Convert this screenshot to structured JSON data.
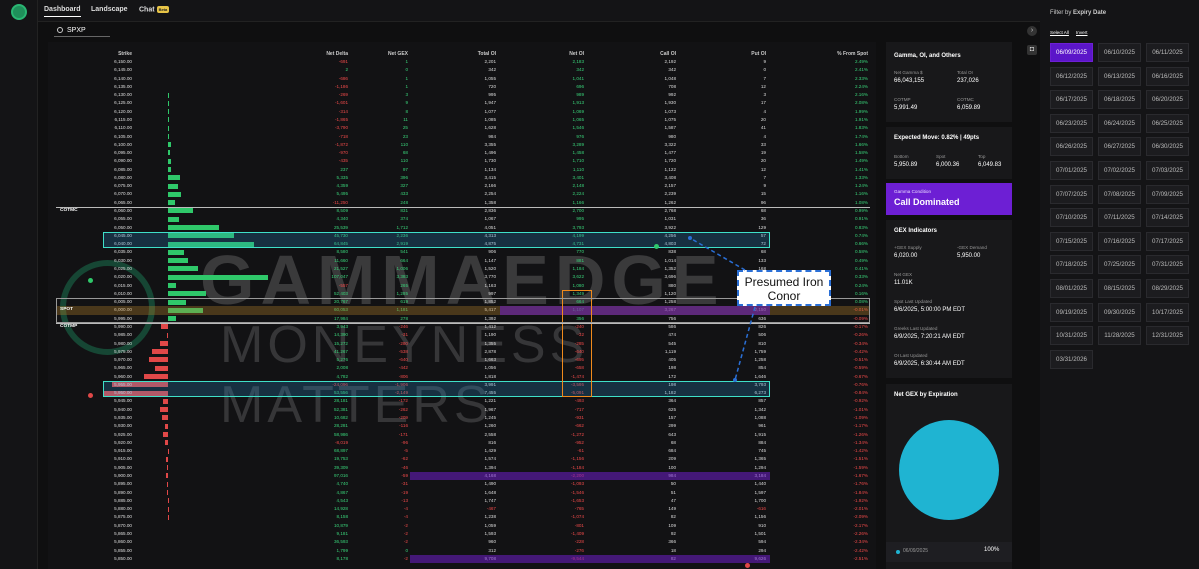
{
  "nav": {
    "tabs": [
      "Dashboard",
      "Landscape",
      "Chat"
    ],
    "beta": "Beta"
  },
  "search": {
    "value": "SPXP"
  },
  "table": {
    "headers": [
      "Strike",
      "Net Delta",
      "Net GEX",
      "Total OI",
      "Net OI",
      "Call OI",
      "Put OI",
      "% From Spot"
    ],
    "rows": [
      [
        "6,150.00",
        "-691",
        "1",
        "2,201",
        "2,183",
        "2,192",
        "9",
        "2.49%"
      ],
      [
        "6,145.00",
        "2",
        "0",
        "342",
        "342",
        "342",
        "0",
        "2.41%"
      ],
      [
        "6,140.00",
        "-686",
        "1",
        "1,055",
        "1,041",
        "1,048",
        "7",
        "2.33%"
      ],
      [
        "6,135.00",
        "-1,186",
        "1",
        "720",
        "696",
        "708",
        "12",
        "2.24%"
      ],
      [
        "6,130.00",
        "-269",
        "3",
        "995",
        "989",
        "992",
        "3",
        "2.16%"
      ],
      [
        "6,125.00",
        "-1,601",
        "9",
        "1,947",
        "1,913",
        "1,930",
        "17",
        "2.08%"
      ],
      [
        "6,120.00",
        "-314",
        "8",
        "1,077",
        "1,069",
        "1,073",
        "4",
        "1.99%"
      ],
      [
        "6,115.00",
        "-1,865",
        "11",
        "1,085",
        "1,065",
        "1,075",
        "20",
        "1.91%"
      ],
      [
        "6,110.00",
        "-3,790",
        "25",
        "1,628",
        "1,546",
        "1,587",
        "41",
        "1.83%"
      ],
      [
        "6,105.00",
        "-718",
        "23",
        "984",
        "976",
        "980",
        "4",
        "1.74%"
      ],
      [
        "6,100.00",
        "-1,872",
        "110",
        "3,355",
        "3,289",
        "3,322",
        "33",
        "1.66%"
      ],
      [
        "6,095.00",
        "-970",
        "68",
        "1,496",
        "1,458",
        "1,477",
        "19",
        "1.58%"
      ],
      [
        "6,090.00",
        "-435",
        "110",
        "1,730",
        "1,710",
        "1,720",
        "20",
        "1.49%"
      ],
      [
        "6,085.00",
        "237",
        "97",
        "1,134",
        "1,110",
        "1,122",
        "12",
        "1.41%"
      ],
      [
        "6,080.00",
        "5,335",
        "396",
        "3,415",
        "3,401",
        "3,408",
        "7",
        "1.33%"
      ],
      [
        "6,075.00",
        "4,359",
        "327",
        "2,166",
        "2,148",
        "2,157",
        "9",
        "1.24%"
      ],
      [
        "6,070.00",
        "5,495",
        "433",
        "2,254",
        "2,224",
        "2,239",
        "15",
        "1.16%"
      ],
      [
        "6,065.00",
        "-11,250",
        "248",
        "1,358",
        "1,166",
        "1,262",
        "96",
        "1.08%"
      ],
      [
        "6,060.00",
        "8,509",
        "831",
        "2,836",
        "2,700",
        "2,768",
        "68",
        "0.99%"
      ],
      [
        "6,055.00",
        "4,340",
        "374",
        "1,067",
        "995",
        "1,031",
        "36",
        "0.91%"
      ],
      [
        "6,050.00",
        "25,539",
        "1,712",
        "4,051",
        "3,793",
        "3,922",
        "129",
        "0.83%"
      ],
      [
        "6,045.00",
        "45,730",
        "2,236",
        "4,313",
        "4,199",
        "4,256",
        "57",
        "0.74%"
      ],
      [
        "6,040.00",
        "64,845",
        "2,919",
        "4,875",
        "4,731",
        "4,803",
        "72",
        "0.66%"
      ],
      [
        "6,035.00",
        "8,580",
        "541",
        "906",
        "770",
        "838",
        "68",
        "0.58%"
      ],
      [
        "6,030.00",
        "11,660",
        "664",
        "1,147",
        "881",
        "1,014",
        "133",
        "0.49%"
      ],
      [
        "6,025.00",
        "21,527",
        "1,006",
        "1,520",
        "1,184",
        "1,352",
        "168",
        "0.41%"
      ],
      [
        "6,020.00",
        "107,047",
        "3,383",
        "3,770",
        "3,622",
        "3,696",
        "74",
        "0.33%"
      ],
      [
        "6,015.00",
        "-557",
        "265",
        "1,163",
        "1,080",
        "880",
        "283",
        "0.24%"
      ],
      [
        "6,010.00",
        "52,403",
        "1,285",
        "997",
        "1,349",
        "1,120",
        "223",
        "0.16%"
      ],
      [
        "6,005.00",
        "20,767",
        "619",
        "1,852",
        "664",
        "1,258",
        "594",
        "0.08%"
      ],
      [
        "6,000.00",
        "60,053",
        "1,181",
        "5,417",
        "1,107",
        "3,267",
        "2,150",
        "-0.01%"
      ],
      [
        "5,995.00",
        "17,984",
        "278",
        "1,392",
        "356",
        "756",
        "636",
        "-0.09%"
      ],
      [
        "5,990.00",
        "3,943",
        "-246",
        "1,412",
        "-240",
        "586",
        "826",
        "-0.17%"
      ],
      [
        "5,985.00",
        "14,390",
        "-31",
        "1,190",
        "-32",
        "474",
        "506",
        "-0.26%"
      ],
      [
        "5,980.00",
        "15,272",
        "-280",
        "1,355",
        "-285",
        "545",
        "810",
        "-0.34%"
      ],
      [
        "5,975.00",
        "41,267",
        "-538",
        "2,878",
        "-640",
        "1,119",
        "1,759",
        "-0.42%"
      ],
      [
        "5,970.00",
        "5,276",
        "-640",
        "1,663",
        "-695",
        "405",
        "1,258",
        "-0.51%"
      ],
      [
        "5,965.00",
        "2,008",
        "-442",
        "1,056",
        "-658",
        "198",
        "854",
        "-0.59%"
      ],
      [
        "5,960.00",
        "4,782",
        "-806",
        "1,818",
        "-1,474",
        "172",
        "1,646",
        "-0.67%"
      ],
      [
        "5,955.00",
        "-24,096",
        "-1,906",
        "3,991",
        "-3,595",
        "198",
        "3,793",
        "-0.76%"
      ],
      [
        "5,950.00",
        "53,556",
        "-2,149",
        "7,455",
        "-5,091",
        "1,182",
        "6,273",
        "-0.84%"
      ],
      [
        "5,945.00",
        "28,181",
        "-172",
        "1,221",
        "-493",
        "364",
        "857",
        "-0.92%"
      ],
      [
        "5,940.00",
        "52,381",
        "-262",
        "1,967",
        "-717",
        "625",
        "1,342",
        "-1.01%"
      ],
      [
        "5,935.00",
        "10,682",
        "-209",
        "1,245",
        "-931",
        "157",
        "1,088",
        "-1.09%"
      ],
      [
        "5,930.00",
        "28,281",
        "-116",
        "1,260",
        "-662",
        "299",
        "961",
        "-1.17%"
      ],
      [
        "5,925.00",
        "58,986",
        "-171",
        "2,558",
        "-1,272",
        "643",
        "1,915",
        "-1.26%"
      ],
      [
        "5,920.00",
        "-8,019",
        "-96",
        "816",
        "-952",
        "68",
        "884",
        "-1.34%"
      ],
      [
        "5,915.00",
        "68,897",
        "-5",
        "1,429",
        "-61",
        "684",
        "745",
        "-1.42%"
      ],
      [
        "5,910.00",
        "19,753",
        "-62",
        "1,574",
        "-1,156",
        "209",
        "1,365",
        "-1.51%"
      ],
      [
        "5,905.00",
        "39,309",
        "-46",
        "1,394",
        "-1,184",
        "100",
        "1,294",
        "-1.59%"
      ],
      [
        "5,900.00",
        "97,016",
        "-59",
        "4,168",
        "-2,200",
        "984",
        "3,184",
        "-1.67%"
      ],
      [
        "5,895.00",
        "4,740",
        "-31",
        "1,490",
        "-1,093",
        "50",
        "1,440",
        "-1.76%"
      ],
      [
        "5,890.00",
        "4,867",
        "-19",
        "1,648",
        "-1,546",
        "51",
        "1,597",
        "-1.84%"
      ],
      [
        "5,885.00",
        "4,543",
        "-13",
        "1,747",
        "-1,653",
        "47",
        "1,700",
        "-1.92%"
      ],
      [
        "5,880.00",
        "14,928",
        "-4",
        "-467",
        "-765",
        "149",
        "-616",
        "-2.01%"
      ],
      [
        "5,875.00",
        "8,158",
        "-4",
        "1,238",
        "-1,074",
        "82",
        "1,156",
        "-2.09%"
      ],
      [
        "5,870.00",
        "10,879",
        "-2",
        "1,059",
        "-801",
        "109",
        "910",
        "-2.17%"
      ],
      [
        "5,865.00",
        "9,181",
        "-2",
        "1,593",
        "-1,409",
        "92",
        "1,501",
        "-2.26%"
      ],
      [
        "5,860.00",
        "36,593",
        "-2",
        "960",
        "-228",
        "366",
        "594",
        "-2.34%"
      ],
      [
        "5,855.00",
        "1,799",
        "0",
        "312",
        "-276",
        "18",
        "294",
        "-2.42%"
      ],
      [
        "5,850.00",
        "8,178",
        "-2",
        "9,708",
        "-9,544",
        "82",
        "9,626",
        "-2.51%"
      ]
    ],
    "marks": {
      "cotmc": "COTMC",
      "spot": "SPOT",
      "cotmp": "COTMP"
    }
  },
  "watermark": {
    "line1": "GAMMAEDGE",
    "line2": "MONEYNESS MATTERS"
  },
  "annotation": {
    "text": "Presumed Iron Conor"
  },
  "gamma": {
    "title": "Gamma, OI, and Others",
    "net_gamma_label": "Net Gamma $",
    "net_gamma": "66,043,155",
    "total_oi_label": "Total OI",
    "total_oi": "237,026",
    "cotmp_label": "COTMP",
    "cotmp": "5,991.49",
    "cotmc_label": "COTMC",
    "cotmc": "6,059.89"
  },
  "expected": {
    "title": "Expected Move: 0.82% | 49pts",
    "bottom_label": "Bottom",
    "bottom": "5,950.89",
    "spot_label": "Spot",
    "spot": "6,000.36",
    "top_label": "Top",
    "top": "6,049.83"
  },
  "condition": {
    "label": "Gamma Condition",
    "value": "Call Dominated"
  },
  "gex": {
    "title": "GEX Indicators",
    "supply_label": "+GEX Supply",
    "supply": "6,020.00",
    "demand_label": "-GEX Demand",
    "demand": "5,950.00",
    "net_label": "Net GEX",
    "net": "11.01K",
    "spot_updated_label": "Spot Last Updated",
    "spot_updated": "6/6/2025, 5:00:00 PM EDT",
    "greeks_label": "Greeks Last Updated",
    "greeks_updated": "6/9/2025, 7:20:21 AM EDT",
    "oi_label": "OI Last Updated",
    "oi_updated": "6/9/2025, 6:30:44 AM EDT"
  },
  "pie": {
    "title": "Net GEX by Expiration",
    "legend": "06/09/2025",
    "pct": "100%",
    "color": "#1fb4d2"
  },
  "filter": {
    "title": "Filter by",
    "title_b": "Expiry Date",
    "select_all": "Select All",
    "invert": "Invert",
    "dates": [
      "06/09/2025",
      "06/10/2025",
      "06/11/2025",
      "06/12/2025",
      "06/13/2025",
      "06/16/2025",
      "06/17/2025",
      "06/18/2025",
      "06/20/2025",
      "06/23/2025",
      "06/24/2025",
      "06/25/2025",
      "06/26/2025",
      "06/27/2025",
      "06/30/2025",
      "07/01/2025",
      "07/02/2025",
      "07/03/2025",
      "07/07/2025",
      "07/08/2025",
      "07/09/2025",
      "07/10/2025",
      "07/11/2025",
      "07/14/2025",
      "07/15/2025",
      "07/16/2025",
      "07/17/2025",
      "07/18/2025",
      "07/25/2025",
      "07/31/2025",
      "08/01/2025",
      "08/15/2025",
      "08/29/2025",
      "09/19/2025",
      "09/30/2025",
      "10/17/2025",
      "10/31/2025",
      "11/28/2025",
      "12/31/2025",
      "03/31/2026"
    ]
  }
}
